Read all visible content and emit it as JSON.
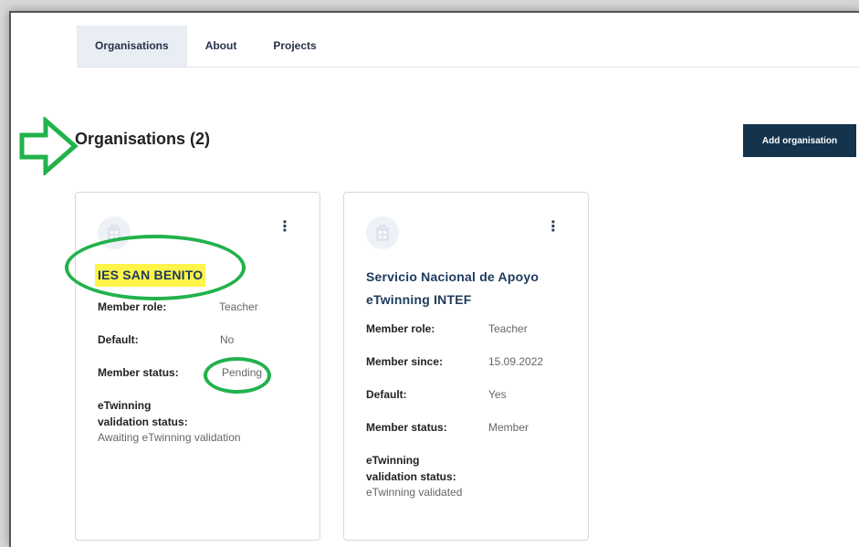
{
  "tabs": [
    {
      "label": "Organisations",
      "active": true
    },
    {
      "label": "About",
      "active": false
    },
    {
      "label": "Projects",
      "active": false
    }
  ],
  "page": {
    "title": "Organisations (2)",
    "add_button_label": "Add organisation"
  },
  "organisations": [
    {
      "name": "IES SAN BENITO",
      "rows": [
        {
          "label": "Member role:",
          "value": "Teacher"
        },
        {
          "label": "Default:",
          "value": "No"
        },
        {
          "label": "Member status:",
          "value": "Pending"
        }
      ],
      "validation_label_line1": "eTwinning",
      "validation_label_line2": "validation status:",
      "validation_value": "Awaiting eTwinning validation"
    },
    {
      "name_line1": "Servicio Nacional de Apoyo",
      "name_line2": "eTwinning INTEF",
      "rows": [
        {
          "label": "Member role:",
          "value": "Teacher"
        },
        {
          "label": "Member since:",
          "value": "15.09.2022"
        },
        {
          "label": "Default:",
          "value": "Yes"
        },
        {
          "label": "Member status:",
          "value": "Member"
        }
      ],
      "validation_label_line1": "eTwinning",
      "validation_label_line2": "validation status:",
      "validation_value": "eTwinning validated"
    }
  ],
  "annotation_color": "#22b24c",
  "highlight_color": "#fff44a",
  "icons": {
    "menu": "kebab-menu-icon",
    "pointer": "arrow-right-icon",
    "logo": "organisation-logo-icon"
  }
}
